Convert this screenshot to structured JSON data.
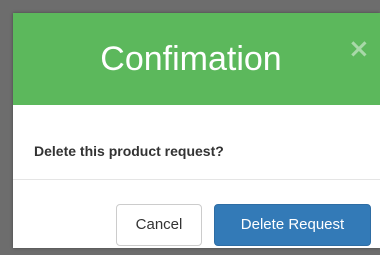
{
  "dialog": {
    "title": "Confimation",
    "close_symbol": "×",
    "message": "Delete this product request?",
    "cancel_label": "Cancel",
    "confirm_label": "Delete Request"
  },
  "colors": {
    "header": "#5cb85c",
    "primary_button": "#337ab7",
    "backdrop": "#6d6d6d"
  },
  "icons": {
    "close": "close-icon"
  }
}
